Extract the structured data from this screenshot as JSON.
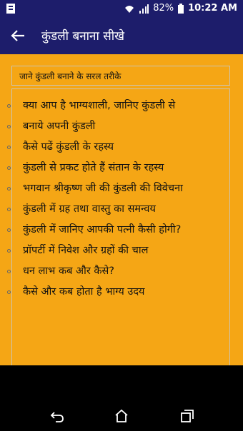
{
  "status_bar": {
    "battery": "82%",
    "time": "10:22 AM"
  },
  "app_bar": {
    "title": "कुंडली बनाना सीखे"
  },
  "header": {
    "text": "जाने कुंडली बनाने के सरल तरीके"
  },
  "items": [
    {
      "label": "क्या आप है भाग्यशाली, जानिए कुंडली से"
    },
    {
      "label": "बनाये अपनी कुंडली"
    },
    {
      "label": "कैसे पढें कुंडली के रहस्य"
    },
    {
      "label": "कुंडली से प्रकट होते हैं संतान के रहस्य"
    },
    {
      "label": "भगवान श्रीकृष्ण जी की कुंडली की विवेचना"
    },
    {
      "label": "कुंडली में ग्रह तथा वास्तु का समन्वय"
    },
    {
      "label": "कुंडली में जानिए आपकी पत्नी कैसी होगी?"
    },
    {
      "label": "प्रॉपर्टी में निवेश और ग्रहों की चाल"
    },
    {
      "label": "धन लाभ कब और कैसे?"
    },
    {
      "label": "कैसे और कब होता है भाग्य उदय"
    }
  ],
  "icons": {
    "notification": "notification-icon",
    "wifi": "wifi-icon",
    "signal": "signal-icon",
    "battery": "battery-icon",
    "back": "arrow-left-icon",
    "nav_back": "nav-back-icon",
    "nav_home": "nav-home-icon",
    "nav_recents": "nav-recents-icon"
  },
  "colors": {
    "app_bar": "#1d1d6b",
    "content_bg": "#f5a615",
    "nav_bar": "#000000"
  }
}
